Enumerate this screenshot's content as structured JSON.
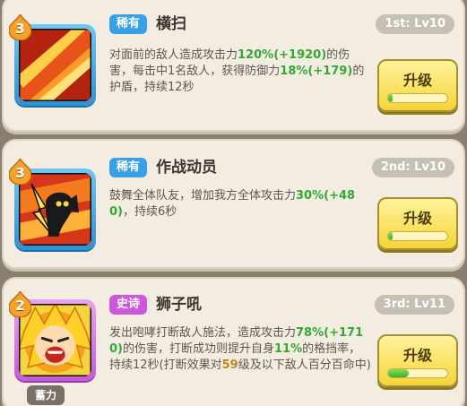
{
  "skills": [
    {
      "level": "3",
      "rarity": "稀有",
      "rarity_color": "#3aa0e6",
      "name": "横扫",
      "rank": "1st: Lv10",
      "description_parts": [
        "对面前的敌人造成攻击力",
        "120%",
        "(+1920)",
        "的伤害，每击中1名敌人，获得防御力",
        "18%",
        "(+179)",
        "的护盾，持续12秒"
      ],
      "upgrade_label": "升级",
      "progress": 0.08,
      "icon": "slash-swipe-icon"
    },
    {
      "level": "3",
      "rarity": "稀有",
      "rarity_color": "#3aa0e6",
      "name": "作战动员",
      "rank": "2nd: Lv10",
      "description_parts": [
        "鼓舞全体队友，增加我方全体攻击力",
        "30%",
        "(+480)",
        "，持续6秒"
      ],
      "upgrade_label": "升级",
      "progress": 0.08,
      "icon": "rally-horn-icon"
    },
    {
      "level": "2",
      "rarity": "史诗",
      "rarity_color": "#cc58dc",
      "name": "狮子吼",
      "rank": "3rd: Lv11",
      "description_parts": [
        "发出咆哮打断敌人施法，造成攻击力",
        "78%",
        "(+1710)",
        "的伤害，打断成功则提升自身",
        "11%",
        "的格挡率，持续12秒(打断效果对",
        "59",
        "级及以下敌人百分百命中)"
      ],
      "upgrade_label": "升级",
      "progress": 0.35,
      "icon": "lion-roar-icon",
      "tag": "蓄力"
    }
  ]
}
